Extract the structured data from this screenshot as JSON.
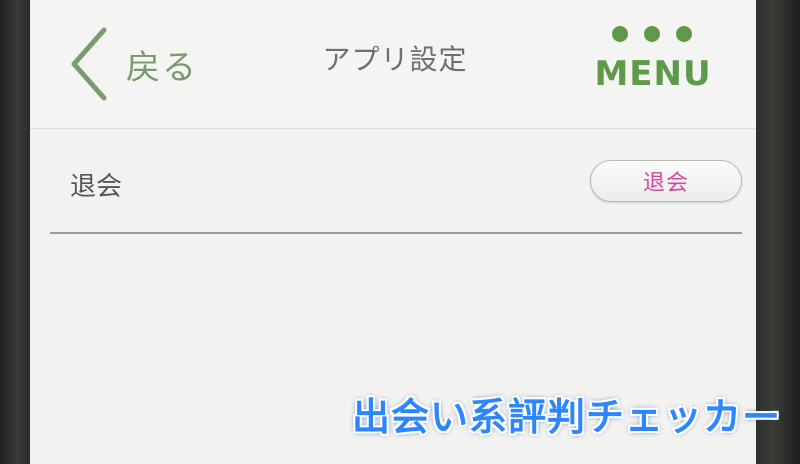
{
  "nav": {
    "back_label": "戻る",
    "title": "アプリ設定",
    "menu_label": "MENU"
  },
  "settings": {
    "rows": [
      {
        "label": "退会",
        "button_label": "退会"
      }
    ]
  },
  "watermark": {
    "text": "出会い系評判チェッカー"
  },
  "colors": {
    "accent_green": "#5f9a4c",
    "back_green": "#7a9a70",
    "withdraw_pink": "#d44aa0",
    "watermark_blue": "#2b86ff",
    "screen_bg": "#f2f2f0"
  },
  "icons": {
    "back": "chevron-left-icon",
    "menu": "three-dots-icon"
  }
}
